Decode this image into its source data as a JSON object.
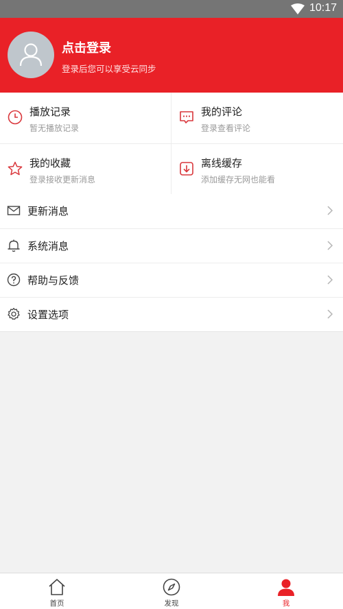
{
  "status_bar": {
    "time": "10:17"
  },
  "header": {
    "login_title": "点击登录",
    "login_subtitle": "登录后您可以享受云同步"
  },
  "grid": [
    {
      "title": "播放记录",
      "subtitle": "暂无播放记录",
      "icon": "clock-icon"
    },
    {
      "title": "我的评论",
      "subtitle": "登录查看评论",
      "icon": "comment-icon"
    },
    {
      "title": "我的收藏",
      "subtitle": "登录接收更新消息",
      "icon": "star-icon"
    },
    {
      "title": "离线缓存",
      "subtitle": "添加缓存无网也能看",
      "icon": "download-icon"
    }
  ],
  "menu": [
    {
      "label": "更新消息",
      "icon": "mail-icon"
    },
    {
      "label": "系统消息",
      "icon": "bell-icon"
    },
    {
      "label": "帮助与反馈",
      "icon": "help-icon"
    },
    {
      "label": "设置选项",
      "icon": "gear-icon"
    }
  ],
  "tabbar": [
    {
      "label": "首页",
      "icon": "home-icon",
      "active": false
    },
    {
      "label": "发现",
      "icon": "compass-icon",
      "active": false
    },
    {
      "label": "我",
      "icon": "user-icon",
      "active": true
    }
  ],
  "colors": {
    "accent": "#e92127",
    "icon_stroke": "#d9363b",
    "background": "#f2f2f2"
  }
}
